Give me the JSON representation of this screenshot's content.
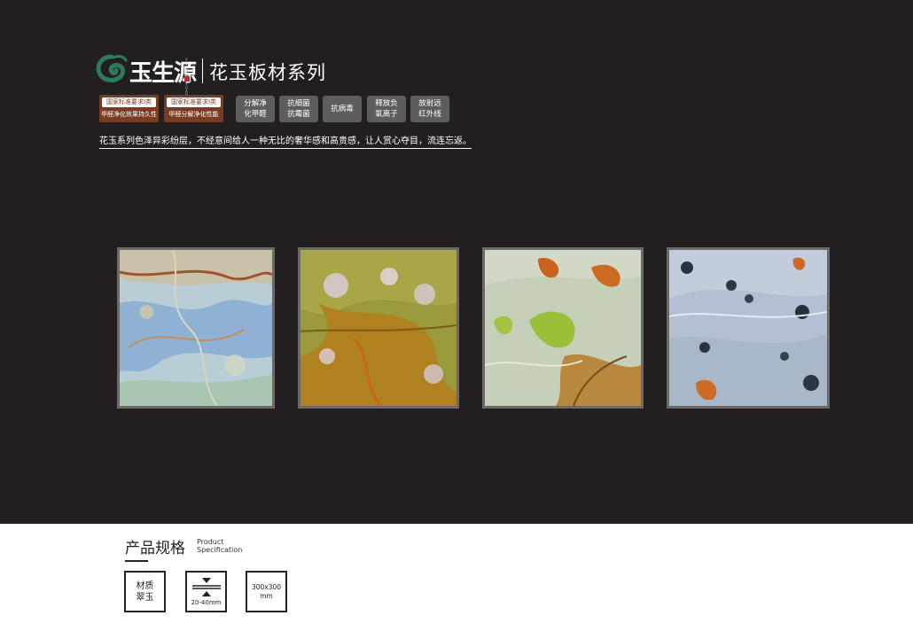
{
  "brand": {
    "name": "玉生源",
    "vertical_text": "YUSHENGYUAN"
  },
  "header": {
    "series_title": "花玉板材系列"
  },
  "standard_badges": [
    {
      "top": "国家标准要求I类",
      "bottom": "甲醛净化效果持久性"
    },
    {
      "top": "国家标准要求I类",
      "bottom": "甲醛分解净化性能"
    }
  ],
  "features": [
    {
      "line1": "分解净",
      "line2": "化甲醛"
    },
    {
      "line1": "抗细菌",
      "line2": "抗霉菌"
    },
    {
      "line1": "抗病毒",
      "line2": ""
    },
    {
      "line1": "释放负",
      "line2": "氧离子"
    },
    {
      "line1": "放射远",
      "line2": "红外线"
    }
  ],
  "tagline": "花玉系列色泽异彩纷层，不经意间给人一种无比的奢华感和高贵感，让人赏心夺目，流连忘返。",
  "colors": {
    "background_dark": "#231f20",
    "badge_brown": "#7a3b23",
    "feature_gray": "#5d5d5d",
    "brand_green": "#2f7a5a"
  },
  "spec": {
    "title_cn": "产品规格",
    "title_en_1": "Product",
    "title_en_2": "Specification",
    "material_label": "材质",
    "material_value": "翠玉",
    "thickness": "20-40mm",
    "size_line1": "300x300",
    "size_line2": "mm"
  }
}
